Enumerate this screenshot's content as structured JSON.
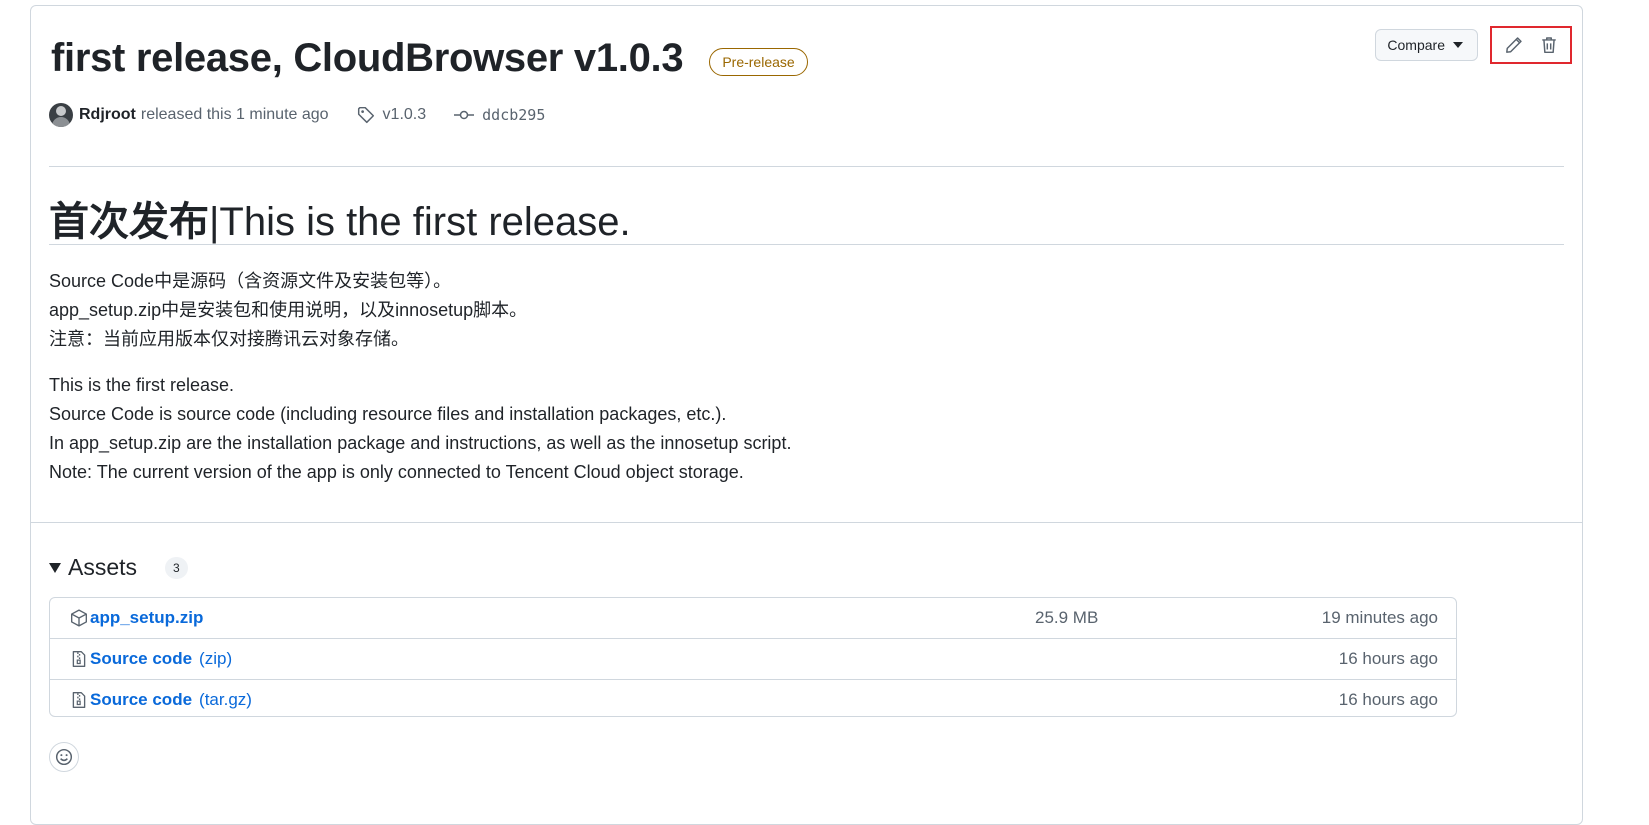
{
  "release": {
    "title": "first release, CloudBrowser v1.0.3",
    "badge": "Pre-release",
    "author": "Rdjroot",
    "released_text": "released this 1 minute ago",
    "tag": "v1.0.3",
    "commit": "ddcb295"
  },
  "actions": {
    "compare_label": "Compare",
    "edit_icon": "pencil-icon",
    "delete_icon": "trash-icon"
  },
  "body": {
    "heading_cn": "首次发布",
    "heading_rest": "|This is the first release.",
    "cn_lines": [
      "Source Code中是源码（含资源文件及安装包等）。",
      "app_setup.zip中是安装包和使用说明，以及innosetup脚本。",
      "注意：当前应用版本仅对接腾讯云对象存储。"
    ],
    "en_lines": [
      "This is the first release.",
      "Source Code is source code (including resource files and installation packages, etc.).",
      "In app_setup.zip are the installation package and instructions, as well as the innosetup script.",
      "Note: The current version of the app is only connected to Tencent Cloud object storage."
    ]
  },
  "assets": {
    "heading": "Assets",
    "count": "3",
    "items": [
      {
        "name": "app_setup.zip",
        "ext": "",
        "size": "25.9 MB",
        "time": "19 minutes ago",
        "icon": "package-icon"
      },
      {
        "name": "Source code",
        "ext": "(zip)",
        "size": "",
        "time": "16 hours ago",
        "icon": "file-zip-icon"
      },
      {
        "name": "Source code",
        "ext": "(tar.gz)",
        "size": "",
        "time": "16 hours ago",
        "icon": "file-zip-icon"
      }
    ]
  },
  "colors": {
    "link": "#0969da",
    "prerelease": "#9a6700",
    "highlight_box": "#e0282e",
    "border": "#d0d7de"
  }
}
